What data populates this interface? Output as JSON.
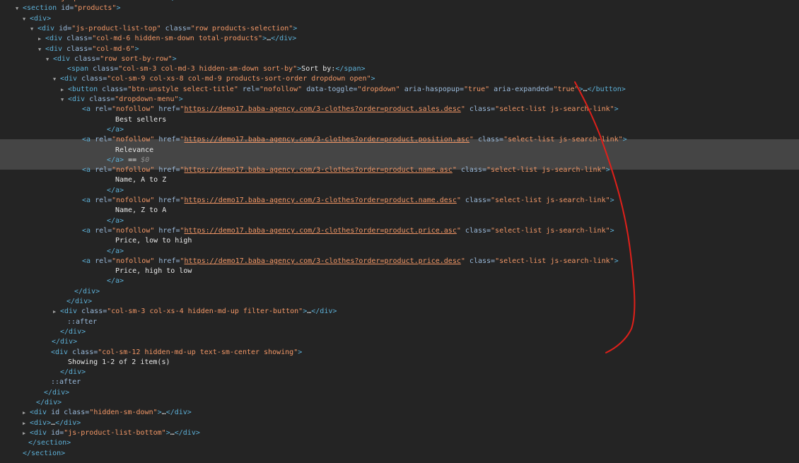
{
  "devtools": {
    "accent_annotation_color": "#e0201a",
    "lines": [
      {
        "indent": 32,
        "arrow": "",
        "parts": [
          {
            "t": "tag",
            "v": "<div"
          },
          {
            "t": "an",
            "v": " id="
          },
          {
            "t": "av",
            "v": "\"js-product-list-header\""
          },
          {
            "t": "tag",
            "v": ">"
          },
          {
            "t": "tx",
            "v": "…"
          },
          {
            "t": "tag",
            "v": "</div>"
          }
        ]
      },
      {
        "indent": 32,
        "arrow": "▼",
        "parts": [
          {
            "t": "tag",
            "v": "<section"
          },
          {
            "t": "an",
            "v": " id="
          },
          {
            "t": "av",
            "v": "\"products\""
          },
          {
            "t": "tag",
            "v": ">"
          }
        ]
      },
      {
        "indent": 42,
        "arrow": "▼",
        "parts": [
          {
            "t": "tag",
            "v": "<div>"
          }
        ]
      },
      {
        "indent": 53,
        "arrow": "▼",
        "parts": [
          {
            "t": "tag",
            "v": "<div"
          },
          {
            "t": "an",
            "v": " id="
          },
          {
            "t": "av",
            "v": "\"js-product-list-top\""
          },
          {
            "t": "an",
            "v": " class="
          },
          {
            "t": "av",
            "v": "\"row products-selection\""
          },
          {
            "t": "tag",
            "v": ">"
          }
        ]
      },
      {
        "indent": 64,
        "arrow": "▶",
        "parts": [
          {
            "t": "tag",
            "v": "<div"
          },
          {
            "t": "an",
            "v": " class="
          },
          {
            "t": "av",
            "v": "\"col-md-6 hidden-sm-down total-products\""
          },
          {
            "t": "tag",
            "v": ">"
          },
          {
            "t": "tx",
            "v": "…"
          },
          {
            "t": "tag",
            "v": "</div>"
          }
        ]
      },
      {
        "indent": 64,
        "arrow": "▼",
        "parts": [
          {
            "t": "tag",
            "v": "<div"
          },
          {
            "t": "an",
            "v": " class="
          },
          {
            "t": "av",
            "v": "\"col-md-6\""
          },
          {
            "t": "tag",
            "v": ">"
          }
        ]
      },
      {
        "indent": 75,
        "arrow": "▼",
        "parts": [
          {
            "t": "tag",
            "v": "<div"
          },
          {
            "t": "an",
            "v": " class="
          },
          {
            "t": "av",
            "v": "\"row sort-by-row\""
          },
          {
            "t": "tag",
            "v": ">"
          }
        ]
      },
      {
        "indent": 95,
        "arrow": "",
        "parts": [
          {
            "t": "tag",
            "v": "<span"
          },
          {
            "t": "an",
            "v": " class="
          },
          {
            "t": "av",
            "v": "\"col-sm-3 col-md-3 hidden-sm-down sort-by\""
          },
          {
            "t": "tag",
            "v": ">"
          },
          {
            "t": "tx",
            "v": "Sort by:"
          },
          {
            "t": "tag",
            "v": "</span>"
          }
        ]
      },
      {
        "indent": 85,
        "arrow": "▼",
        "parts": [
          {
            "t": "tag",
            "v": "<div"
          },
          {
            "t": "an",
            "v": " class="
          },
          {
            "t": "av",
            "v": "\"col-sm-9 col-xs-8 col-md-9 products-sort-order dropdown open\""
          },
          {
            "t": "tag",
            "v": ">"
          }
        ]
      },
      {
        "indent": 96,
        "arrow": "▶",
        "parts": [
          {
            "t": "tag",
            "v": "<button"
          },
          {
            "t": "an",
            "v": " class="
          },
          {
            "t": "av",
            "v": "\"btn-unstyle select-title\""
          },
          {
            "t": "an",
            "v": " rel="
          },
          {
            "t": "av",
            "v": "\"nofollow\""
          },
          {
            "t": "an",
            "v": " data-toggle="
          },
          {
            "t": "av",
            "v": "\"dropdown\""
          },
          {
            "t": "an",
            "v": " aria-haspopup="
          },
          {
            "t": "av",
            "v": "\"true\""
          },
          {
            "t": "an",
            "v": " aria-expanded="
          },
          {
            "t": "av",
            "v": "\"true\""
          },
          {
            "t": "tag",
            "v": ">"
          },
          {
            "t": "tx",
            "v": "…"
          },
          {
            "t": "tag",
            "v": "</button>"
          }
        ]
      },
      {
        "indent": 96,
        "arrow": "▼",
        "parts": [
          {
            "t": "tag",
            "v": "<div"
          },
          {
            "t": "an",
            "v": " class="
          },
          {
            "t": "av",
            "v": "\"dropdown-menu\""
          },
          {
            "t": "tag",
            "v": ">"
          }
        ]
      },
      {
        "indent": 116,
        "arrow": "",
        "parts": [
          {
            "t": "tag",
            "v": "<a"
          },
          {
            "t": "an",
            "v": " rel="
          },
          {
            "t": "av",
            "v": "\"nofollow\""
          },
          {
            "t": "an",
            "v": " href="
          },
          {
            "t": "av",
            "v": "\""
          },
          {
            "t": "link",
            "v": "https://demo17.baba-agency.com/3-clothes?order=product.sales.desc"
          },
          {
            "t": "av",
            "v": "\""
          },
          {
            "t": "an",
            "v": " class="
          },
          {
            "t": "av",
            "v": "\"select-list js-search-link\""
          },
          {
            "t": "tag",
            "v": ">"
          }
        ]
      },
      {
        "indent": 163,
        "arrow": "",
        "parts": [
          {
            "t": "tx",
            "v": "Best sellers"
          }
        ]
      },
      {
        "indent": 151,
        "arrow": "",
        "parts": [
          {
            "t": "tag",
            "v": "</a>"
          }
        ]
      },
      {
        "indent": 116,
        "arrow": "",
        "sel": true,
        "parts": [
          {
            "t": "tag",
            "v": "<a"
          },
          {
            "t": "an",
            "v": " rel="
          },
          {
            "t": "av",
            "v": "\"nofollow\""
          },
          {
            "t": "an",
            "v": " href="
          },
          {
            "t": "av",
            "v": "\""
          },
          {
            "t": "link",
            "v": "https://demo17.baba-agency.com/3-clothes?order=product.position.asc"
          },
          {
            "t": "av",
            "v": "\""
          },
          {
            "t": "an",
            "v": " class="
          },
          {
            "t": "av",
            "v": "\"select-list js-search-link\""
          },
          {
            "t": "tag",
            "v": ">"
          }
        ]
      },
      {
        "indent": 163,
        "arrow": "",
        "sel": true,
        "parts": [
          {
            "t": "tx",
            "v": "Relevance"
          }
        ]
      },
      {
        "indent": 151,
        "arrow": "",
        "sel": true,
        "parts": [
          {
            "t": "tag",
            "v": "</a>"
          },
          {
            "t": "tx",
            "v": " == "
          },
          {
            "t": "dim",
            "v": "$0"
          }
        ]
      },
      {
        "indent": 116,
        "arrow": "",
        "parts": [
          {
            "t": "tag",
            "v": "<a"
          },
          {
            "t": "an",
            "v": " rel="
          },
          {
            "t": "av",
            "v": "\"nofollow\""
          },
          {
            "t": "an",
            "v": " href="
          },
          {
            "t": "av",
            "v": "\""
          },
          {
            "t": "link",
            "v": "https://demo17.baba-agency.com/3-clothes?order=product.name.asc"
          },
          {
            "t": "av",
            "v": "\""
          },
          {
            "t": "an",
            "v": " class="
          },
          {
            "t": "av",
            "v": "\"select-list js-search-link\""
          },
          {
            "t": "tag",
            "v": ">"
          }
        ]
      },
      {
        "indent": 163,
        "arrow": "",
        "parts": [
          {
            "t": "tx",
            "v": "Name, A to Z"
          }
        ]
      },
      {
        "indent": 151,
        "arrow": "",
        "parts": [
          {
            "t": "tag",
            "v": "</a>"
          }
        ]
      },
      {
        "indent": 116,
        "arrow": "",
        "parts": [
          {
            "t": "tag",
            "v": "<a"
          },
          {
            "t": "an",
            "v": " rel="
          },
          {
            "t": "av",
            "v": "\"nofollow\""
          },
          {
            "t": "an",
            "v": " href="
          },
          {
            "t": "av",
            "v": "\""
          },
          {
            "t": "link",
            "v": "https://demo17.baba-agency.com/3-clothes?order=product.name.desc"
          },
          {
            "t": "av",
            "v": "\""
          },
          {
            "t": "an",
            "v": " class="
          },
          {
            "t": "av",
            "v": "\"select-list js-search-link\""
          },
          {
            "t": "tag",
            "v": ">"
          }
        ]
      },
      {
        "indent": 163,
        "arrow": "",
        "parts": [
          {
            "t": "tx",
            "v": "Name, Z to A"
          }
        ]
      },
      {
        "indent": 151,
        "arrow": "",
        "parts": [
          {
            "t": "tag",
            "v": "</a>"
          }
        ]
      },
      {
        "indent": 116,
        "arrow": "",
        "parts": [
          {
            "t": "tag",
            "v": "<a"
          },
          {
            "t": "an",
            "v": " rel="
          },
          {
            "t": "av",
            "v": "\"nofollow\""
          },
          {
            "t": "an",
            "v": " href="
          },
          {
            "t": "av",
            "v": "\""
          },
          {
            "t": "link",
            "v": "https://demo17.baba-agency.com/3-clothes?order=product.price.asc"
          },
          {
            "t": "av",
            "v": "\""
          },
          {
            "t": "an",
            "v": " class="
          },
          {
            "t": "av",
            "v": "\"select-list js-search-link\""
          },
          {
            "t": "tag",
            "v": ">"
          }
        ]
      },
      {
        "indent": 163,
        "arrow": "",
        "parts": [
          {
            "t": "tx",
            "v": "Price, low to high"
          }
        ]
      },
      {
        "indent": 151,
        "arrow": "",
        "parts": [
          {
            "t": "tag",
            "v": "</a>"
          }
        ]
      },
      {
        "indent": 116,
        "arrow": "",
        "parts": [
          {
            "t": "tag",
            "v": "<a"
          },
          {
            "t": "an",
            "v": " rel="
          },
          {
            "t": "av",
            "v": "\"nofollow\""
          },
          {
            "t": "an",
            "v": " href="
          },
          {
            "t": "av",
            "v": "\""
          },
          {
            "t": "link",
            "v": "https://demo17.baba-agency.com/3-clothes?order=product.price.desc"
          },
          {
            "t": "av",
            "v": "\""
          },
          {
            "t": "an",
            "v": " class="
          },
          {
            "t": "av",
            "v": "\"select-list js-search-link\""
          },
          {
            "t": "tag",
            "v": ">"
          }
        ]
      },
      {
        "indent": 163,
        "arrow": "",
        "parts": [
          {
            "t": "tx",
            "v": "Price, high to low"
          }
        ]
      },
      {
        "indent": 151,
        "arrow": "",
        "parts": [
          {
            "t": "tag",
            "v": "</a>"
          }
        ]
      },
      {
        "indent": 105,
        "arrow": "",
        "parts": [
          {
            "t": "tag",
            "v": "</div>"
          }
        ]
      },
      {
        "indent": 94,
        "arrow": "",
        "parts": [
          {
            "t": "tag",
            "v": "</div>"
          }
        ]
      },
      {
        "indent": 85,
        "arrow": "▶",
        "parts": [
          {
            "t": "tag",
            "v": "<div"
          },
          {
            "t": "an",
            "v": " class="
          },
          {
            "t": "av",
            "v": "\"col-sm-3 col-xs-4 hidden-md-up filter-button\""
          },
          {
            "t": "tag",
            "v": ">"
          },
          {
            "t": "tx",
            "v": "…"
          },
          {
            "t": "tag",
            "v": "</div>"
          }
        ]
      },
      {
        "indent": 95,
        "arrow": "",
        "parts": [
          {
            "t": "pseudo",
            "v": "::after"
          }
        ]
      },
      {
        "indent": 85,
        "arrow": "",
        "parts": [
          {
            "t": "tag",
            "v": "</div>"
          }
        ]
      },
      {
        "indent": 73,
        "arrow": "",
        "parts": [
          {
            "t": "tag",
            "v": "</div>"
          }
        ]
      },
      {
        "indent": 72,
        "arrow": "",
        "parts": [
          {
            "t": "tag",
            "v": "<div"
          },
          {
            "t": "an",
            "v": " class="
          },
          {
            "t": "av",
            "v": "\"col-sm-12 hidden-md-up text-sm-center showing\""
          },
          {
            "t": "tag",
            "v": ">"
          }
        ]
      },
      {
        "indent": 96,
        "arrow": "",
        "parts": [
          {
            "t": "tx",
            "v": "Showing 1-2 of 2 item(s)"
          }
        ]
      },
      {
        "indent": 85,
        "arrow": "",
        "parts": [
          {
            "t": "tag",
            "v": "</div>"
          }
        ]
      },
      {
        "indent": 72,
        "arrow": "",
        "parts": [
          {
            "t": "pseudo",
            "v": "::after"
          }
        ]
      },
      {
        "indent": 62,
        "arrow": "",
        "parts": [
          {
            "t": "tag",
            "v": "</div>"
          }
        ]
      },
      {
        "indent": 51,
        "arrow": "",
        "parts": [
          {
            "t": "tag",
            "v": "</div>"
          }
        ]
      },
      {
        "indent": 42,
        "arrow": "▶",
        "parts": [
          {
            "t": "tag",
            "v": "<div"
          },
          {
            "t": "an",
            "v": " id"
          },
          {
            "t": "an",
            "v": " class="
          },
          {
            "t": "av",
            "v": "\"hidden-sm-down\""
          },
          {
            "t": "tag",
            "v": ">"
          },
          {
            "t": "tx",
            "v": "…"
          },
          {
            "t": "tag",
            "v": "</div>"
          }
        ]
      },
      {
        "indent": 42,
        "arrow": "▶",
        "parts": [
          {
            "t": "tag",
            "v": "<div>"
          },
          {
            "t": "tx",
            "v": "…"
          },
          {
            "t": "tag",
            "v": "</div>"
          }
        ]
      },
      {
        "indent": 42,
        "arrow": "▶",
        "parts": [
          {
            "t": "tag",
            "v": "<div"
          },
          {
            "t": "an",
            "v": " id="
          },
          {
            "t": "av",
            "v": "\"js-product-list-bottom\""
          },
          {
            "t": "tag",
            "v": ">"
          },
          {
            "t": "tx",
            "v": "…"
          },
          {
            "t": "tag",
            "v": "</div>"
          }
        ]
      },
      {
        "indent": 40,
        "arrow": "",
        "parts": [
          {
            "t": "tag",
            "v": "</section>"
          }
        ]
      },
      {
        "indent": 32,
        "arrow": "",
        "parts": [
          {
            "t": "tag",
            "v": "</section>"
          }
        ]
      }
    ]
  }
}
